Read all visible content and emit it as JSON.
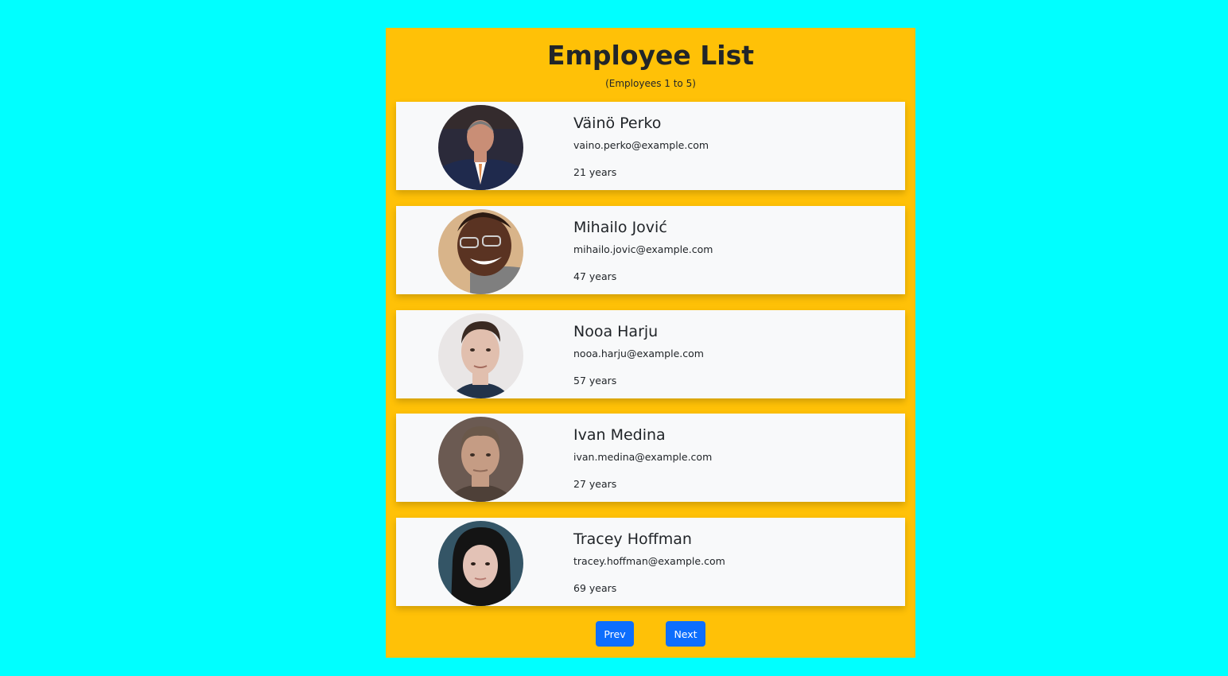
{
  "header": {
    "title": "Employee List",
    "subtitle": "(Employees 1 to 5)"
  },
  "employees": [
    {
      "name": "Väinö Perko",
      "email": "vaino.perko@example.com",
      "age": "21 years",
      "avatar_bg": "#2b2a3a",
      "avatar_skin": "#c98e76",
      "avatar_shirt": "#1f2a4d",
      "avatar_hair": "#7a7a7a"
    },
    {
      "name": "Mihailo Jović",
      "email": "mihailo.jovic@example.com",
      "age": "47 years",
      "avatar_bg": "#d8b48a",
      "avatar_skin": "#5a3322",
      "avatar_shirt": "#7f7f7f",
      "avatar_hair": "#2c1a12"
    },
    {
      "name": "Nooa Harju",
      "email": "nooa.harju@example.com",
      "age": "57 years",
      "avatar_bg": "#e9e6e6",
      "avatar_skin": "#e1bfae",
      "avatar_shirt": "#22334a",
      "avatar_hair": "#3a2a22"
    },
    {
      "name": "Ivan Medina",
      "email": "ivan.medina@example.com",
      "age": "27 years",
      "avatar_bg": "#6b5a52",
      "avatar_skin": "#c59c84",
      "avatar_shirt": "#4e4038",
      "avatar_hair": "#6a584a"
    },
    {
      "name": "Tracey Hoffman",
      "email": "tracey.hoffman@example.com",
      "age": "69 years",
      "avatar_bg": "#345566",
      "avatar_skin": "#e3c2b6",
      "avatar_shirt": "#2a3b45",
      "avatar_hair": "#141414"
    }
  ],
  "pagination": {
    "prev_label": "Prev",
    "next_label": "Next"
  },
  "colors": {
    "page_background": "#00ffff",
    "panel_background": "#ffc107",
    "card_background": "#f8f9fa",
    "button_primary": "#0d6efd"
  }
}
